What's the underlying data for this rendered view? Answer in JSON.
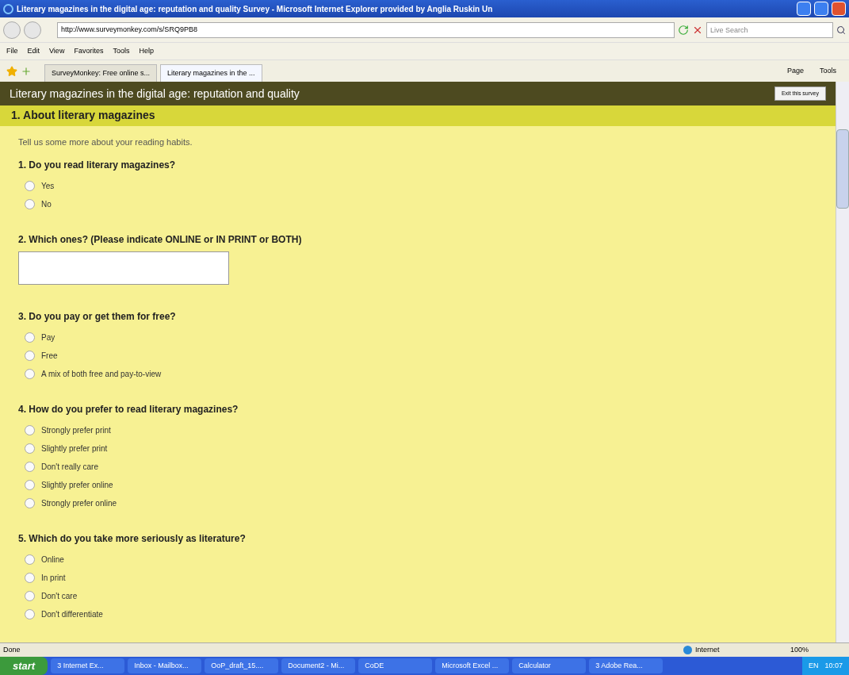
{
  "window": {
    "title": "Literary magazines in the digital age: reputation and quality Survey - Microsoft Internet Explorer provided by Anglia Ruskin Un"
  },
  "address_bar": {
    "url": "http://www.surveymonkey.com/s/SRQ9PB8"
  },
  "search": {
    "placeholder": "Live Search"
  },
  "menu": [
    "File",
    "Edit",
    "View",
    "Favorites",
    "Tools",
    "Help"
  ],
  "tabs": [
    {
      "label": "SurveyMonkey: Free online s...",
      "selected": false
    },
    {
      "label": "Literary magazines in the ...",
      "selected": true
    }
  ],
  "command_bar": [
    "Page",
    "Tools"
  ],
  "survey": {
    "title": "Literary magazines in the digital age: reputation and quality",
    "exit_button": "Exit this survey",
    "section": "1. About literary magazines",
    "intro": "Tell us some more about your reading habits.",
    "questions": [
      {
        "kind": "radio",
        "text": "1. Do you read literary magazines?",
        "options": [
          {
            "label": "Yes",
            "selected": false
          },
          {
            "label": "No",
            "selected": false
          }
        ]
      },
      {
        "kind": "text",
        "text": "2. Which ones? (Please indicate ONLINE or IN PRINT or BOTH)"
      },
      {
        "kind": "radio",
        "text": "3. Do you pay or get them for free?",
        "options": [
          {
            "label": "Pay",
            "selected": false
          },
          {
            "label": "Free",
            "selected": false
          },
          {
            "label": "A mix of both free and pay-to-view",
            "selected": false
          }
        ]
      },
      {
        "kind": "radio",
        "text": "4. How do you prefer to read literary magazines?",
        "options": [
          {
            "label": "Strongly prefer print",
            "selected": false
          },
          {
            "label": "Slightly prefer print",
            "selected": false
          },
          {
            "label": "Don't really care",
            "selected": false
          },
          {
            "label": "Slightly prefer online",
            "selected": false
          },
          {
            "label": "Strongly prefer online",
            "selected": false
          }
        ]
      },
      {
        "kind": "radio",
        "text": "5. Which do you take more seriously as literature?",
        "options": [
          {
            "label": "Online",
            "selected": false
          },
          {
            "label": "In print",
            "selected": false
          },
          {
            "label": "Don't care",
            "selected": false
          },
          {
            "label": "Don't differentiate",
            "selected": false
          }
        ]
      }
    ]
  },
  "status_bar": {
    "status": "Done",
    "zone": "Internet",
    "zoom": "100%"
  },
  "taskbar": {
    "start": "start",
    "items": [
      "3 Internet Ex...",
      "Inbox - Mailbox...",
      "OoP_draft_15....",
      "Document2 - Mi...",
      "CoDE",
      "Microsoft Excel ...",
      "Calculator",
      "3 Adobe Rea..."
    ],
    "language": "EN",
    "clock": "10:07"
  }
}
